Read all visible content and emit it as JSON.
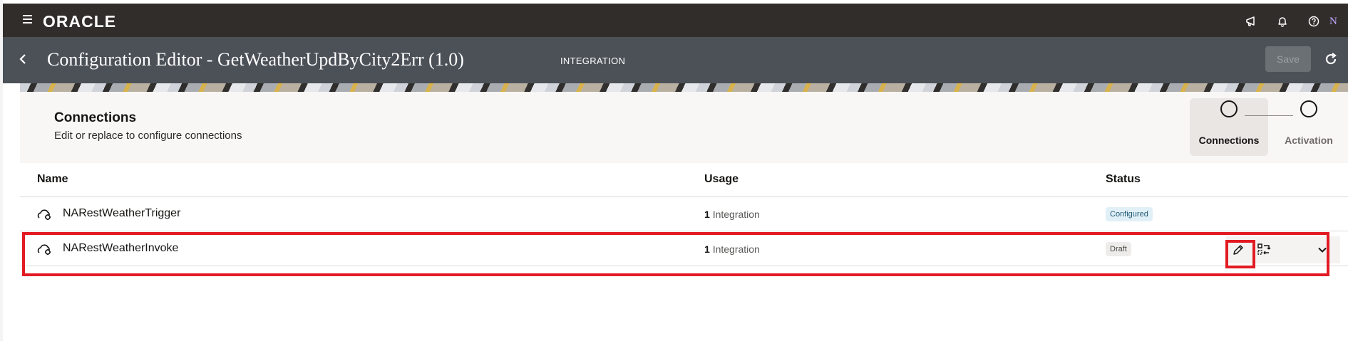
{
  "topbar": {
    "logo": "ORACLE",
    "icons": [
      "announcement-icon",
      "bell-icon",
      "help-icon"
    ],
    "avatar_initial": "N"
  },
  "header": {
    "title": "Configuration Editor - GetWeatherUpdByCity2Err (1.0)",
    "type_label": "INTEGRATION",
    "save_label": "Save"
  },
  "card": {
    "title": "Connections",
    "subtitle": "Edit or replace to configure connections",
    "steps": [
      {
        "label": "Connections",
        "active": true
      },
      {
        "label": "Activation",
        "active": false
      }
    ]
  },
  "table": {
    "columns": [
      "Name",
      "Usage",
      "Status"
    ],
    "rows": [
      {
        "name": "NARestWeatherTrigger",
        "usage_count": "1",
        "usage_label": "Integration",
        "status": "Configured"
      },
      {
        "name": "NARestWeatherInvoke",
        "usage_count": "1",
        "usage_label": "Integration",
        "status": "Draft"
      }
    ]
  },
  "colors": {
    "topbar": "#312d2a",
    "header": "#4c5158",
    "highlight": "#e21b23",
    "configured_badge": "#e1f0f7"
  }
}
